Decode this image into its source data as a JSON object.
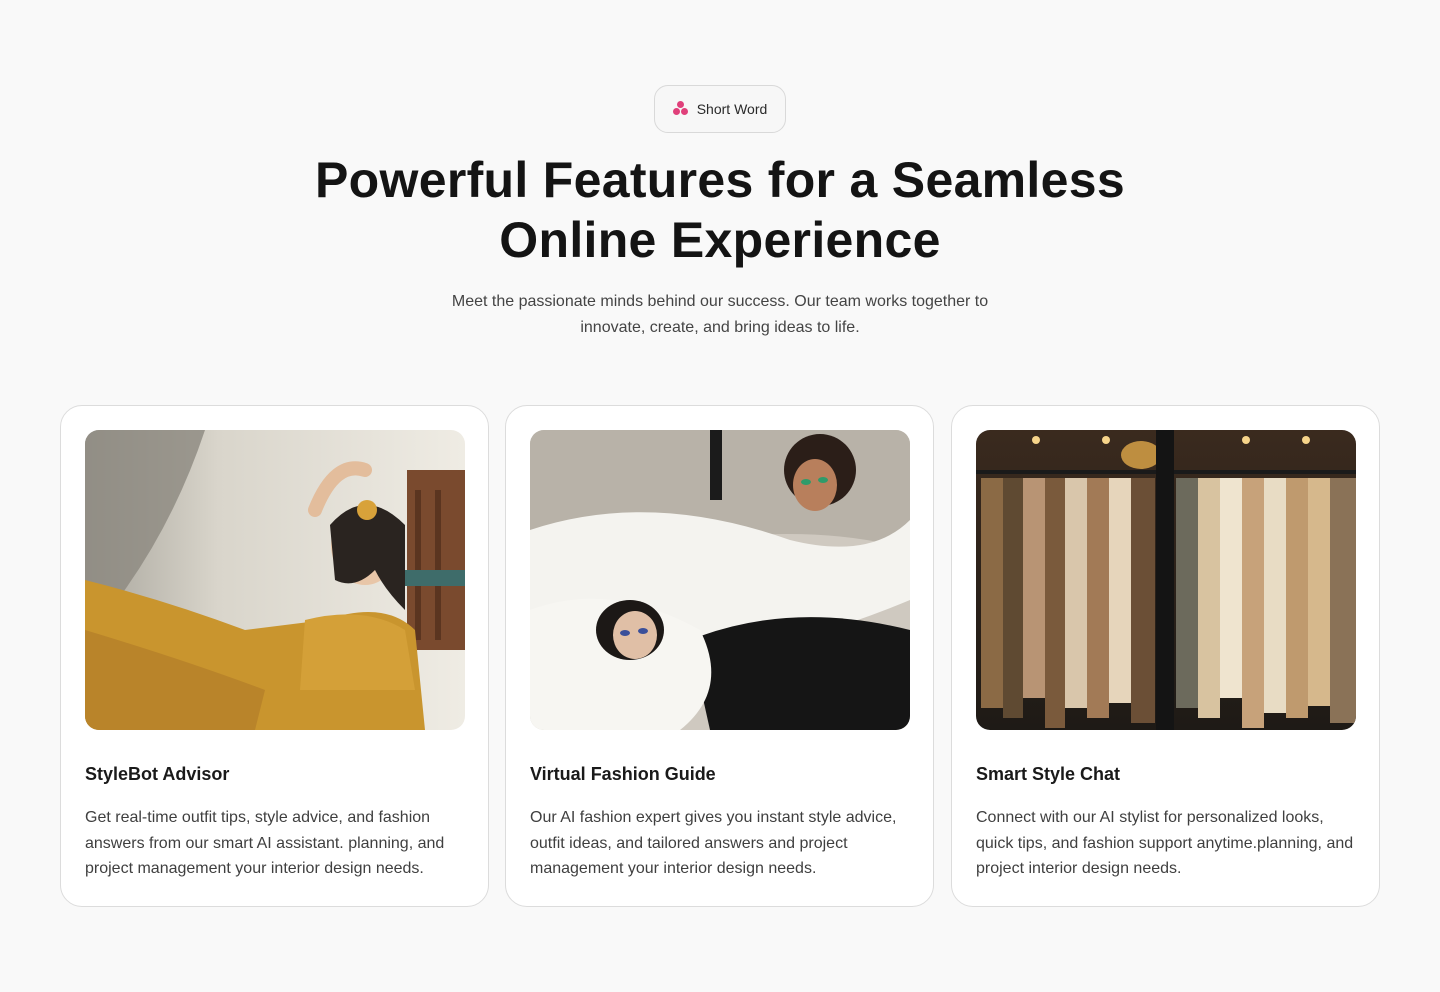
{
  "badge": {
    "label": "Short Word",
    "icon": "flower-icon",
    "icon_color": "#e0407a"
  },
  "heading": {
    "title": "Powerful Features for a Seamless Online Experience"
  },
  "intro": {
    "text": "Meet the passionate minds behind our success. Our team works together to innovate, create, and bring ideas to life."
  },
  "cards": [
    {
      "title": "StyleBot Advisor",
      "description": "Get real-time outfit tips, style advice, and fashion answers from our smart AI assistant. planning, and project management your interior design needs.",
      "image": "woman-in-mustard-dress-photo"
    },
    {
      "title": "Virtual Fashion Guide",
      "description": "Our AI fashion expert gives you instant style advice, outfit ideas, and tailored answers and project management your interior design needs.",
      "image": "two-models-in-white-photo"
    },
    {
      "title": "Smart Style Chat",
      "description": "Connect with our AI stylist for personalized looks, quick tips, and fashion support anytime.planning, and project interior design needs.",
      "image": "clothing-rack-photo"
    }
  ]
}
